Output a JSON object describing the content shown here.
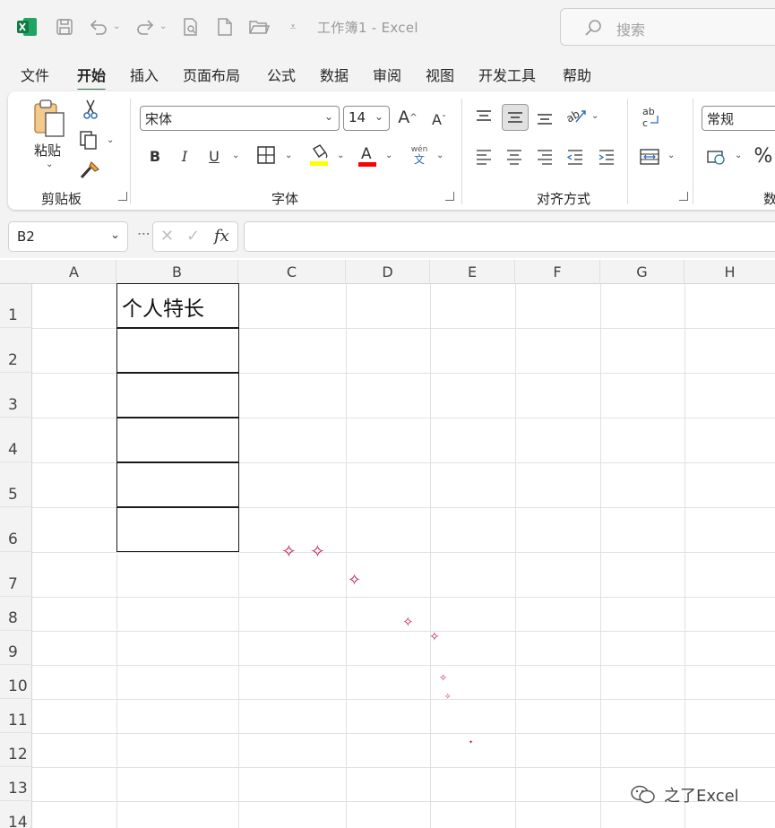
{
  "titlebar": {
    "doc_title": "工作簿1  -  Excel",
    "search_placeholder": "搜索",
    "icons": [
      "excel-logo-icon",
      "save-icon",
      "undo-icon",
      "redo-icon",
      "print-preview-icon",
      "new-file-icon",
      "open-folder-icon",
      "customize-qat-icon",
      "search-icon"
    ]
  },
  "menu": {
    "tabs": [
      "文件",
      "开始",
      "插入",
      "页面布局",
      "公式",
      "数据",
      "审阅",
      "视图",
      "开发工具",
      "帮助"
    ],
    "active": "开始"
  },
  "ribbon": {
    "clipboard": {
      "label": "剪贴板",
      "paste": "粘贴"
    },
    "font": {
      "label": "字体",
      "font_name": "宋体",
      "font_size": "14",
      "bold": "B",
      "italic": "I",
      "underline": "U",
      "phonetic_top": "wén",
      "phonetic_bottom": "文",
      "fill_color": "#ffff00",
      "font_color": "#ff0000"
    },
    "alignment": {
      "label": "对齐方式"
    },
    "number": {
      "label": "数",
      "format": "常规",
      "percent": "%"
    }
  },
  "formula_bar": {
    "name_box": "B2",
    "fx": "fx",
    "content": ""
  },
  "sheet": {
    "columns": [
      "A",
      "B",
      "C",
      "D",
      "E",
      "F",
      "G",
      "H"
    ],
    "rows": [
      "1",
      "2",
      "3",
      "4",
      "5",
      "6",
      "7",
      "8",
      "9",
      "10",
      "11",
      "12",
      "13",
      "14"
    ],
    "cells": {
      "B1": "个人特长"
    }
  },
  "watermark": "之了Excel",
  "colors": {
    "accent": "#1e7145",
    "border": "#1a1a1a",
    "sparkle": "#c2185b"
  }
}
